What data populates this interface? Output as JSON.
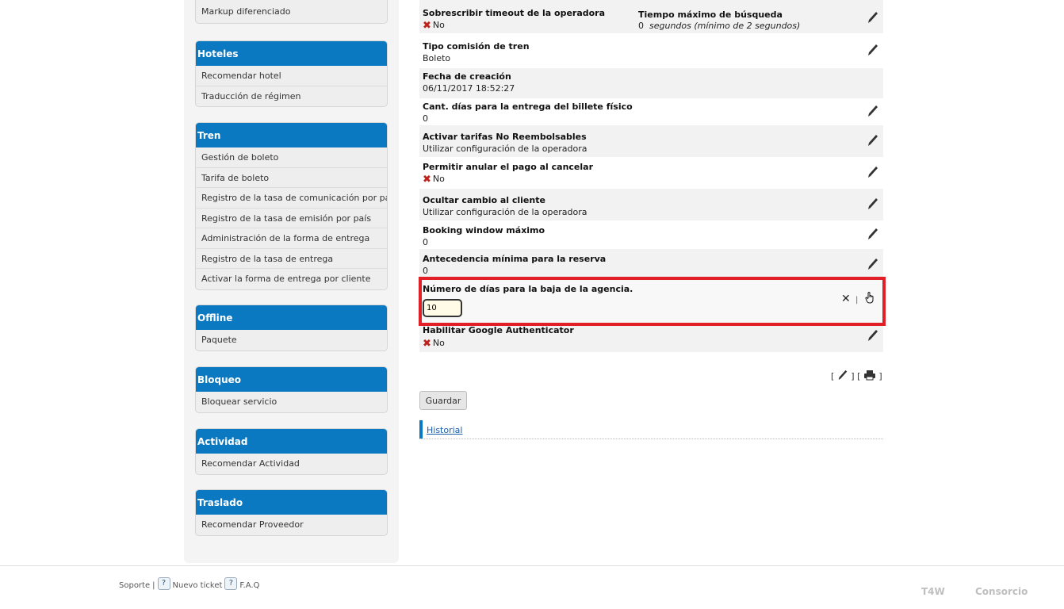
{
  "sidebar": {
    "top_item": "Markup diferenciado",
    "blocks": [
      {
        "title": "Hoteles",
        "items": [
          "Recomendar hotel",
          "Traducción de régimen"
        ]
      },
      {
        "title": "Tren",
        "items": [
          "Gestión de boleto",
          "Tarifa de boleto",
          "Registro de la tasa de comunicación por país",
          "Registro de la tasa de emisión por país",
          "Administración de la forma de entrega",
          "Registro de la tasa de entrega",
          "Activar la forma de entrega por cliente"
        ]
      },
      {
        "title": "Offline",
        "items": [
          "Paquete"
        ]
      },
      {
        "title": "Bloqueo",
        "items": [
          "Bloquear servicio"
        ]
      },
      {
        "title": "Actividad",
        "items": [
          "Recomendar Actividad"
        ]
      },
      {
        "title": "Traslado",
        "items": [
          "Recomendar Proveedor"
        ]
      }
    ]
  },
  "settings": [
    {
      "label": "Sobrescribir timeout de la operadora",
      "value": "No",
      "negative": true,
      "label2": "Tiempo máximo de búsqueda",
      "value2_num": "0",
      "value2_text": "segundos (mínimo de 2 segundos)"
    },
    {
      "label": "Tipo comisión de tren",
      "value": "Boleto"
    },
    {
      "label": "Fecha de creación",
      "value": "06/11/2017 18:52:27"
    },
    {
      "label": "Cant. días para la entrega del billete físico",
      "value": "0"
    },
    {
      "label": "Activar tarifas No Reembolsables",
      "value": "Utilizar configuración de la operadora"
    },
    {
      "label": "Permitir anular el pago al cancelar",
      "value": "No",
      "negative": true
    },
    {
      "label": "Ocultar cambio al cliente",
      "value": "Utilizar configuración de la operadora"
    },
    {
      "label": "Booking window máximo",
      "value": "0"
    },
    {
      "label": "Antecedencia mínima para la reserva",
      "value": "0"
    },
    {
      "label": "Número de días para la baja de la agencia.",
      "input_value": "10",
      "editing": true
    },
    {
      "label": "Habilitar Google Authenticator",
      "value": "No",
      "negative": true
    }
  ],
  "editing_controls": {
    "cancel": "✕",
    "separator": "|"
  },
  "tools": {
    "open": "[",
    "close": "]"
  },
  "save_label": "Guardar",
  "history_link": "Historial",
  "footer": {
    "support": "Soporte",
    "sep": "|",
    "new_ticket": "Nuevo ticket",
    "faq": "F.A.Q"
  },
  "brands": [
    "T4W",
    "Consorcio"
  ],
  "colors": {
    "accent": "#0a79c2",
    "highlight": "#e01f26",
    "negative": "#c0201a"
  }
}
